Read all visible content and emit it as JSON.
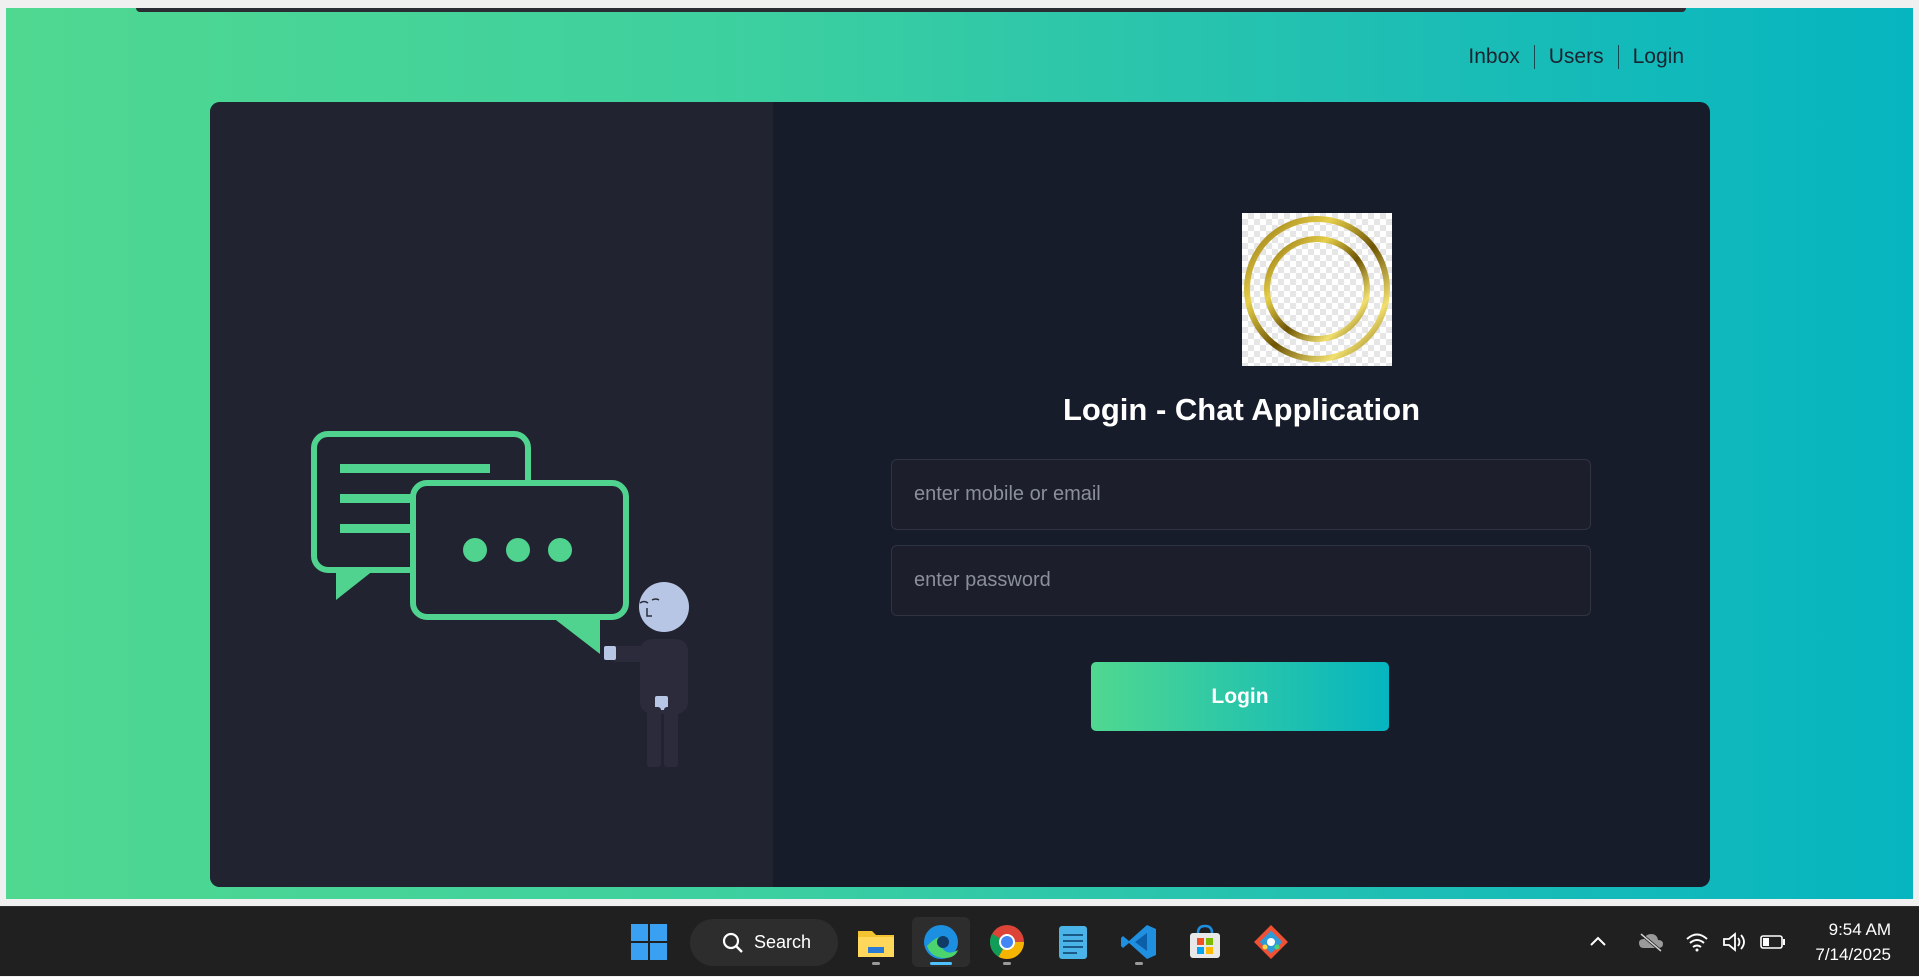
{
  "nav": {
    "items": [
      "Inbox",
      "Users",
      "Login"
    ]
  },
  "login": {
    "title": "Login - Chat Application",
    "email_placeholder": "enter mobile or email",
    "password_placeholder": "enter password",
    "button_label": "Login"
  },
  "taskbar": {
    "search_label": "Search",
    "apps": [
      "windows-start-icon",
      "file-explorer-icon",
      "edge-browser-icon",
      "chrome-icon",
      "notepad-icon",
      "vscode-icon",
      "ms-store-icon",
      "git-icon"
    ],
    "active_app": "edge-browser-icon",
    "time": "9:54 AM",
    "date": "7/14/2025"
  },
  "colors": {
    "accent_start": "#50d890",
    "accent_end": "#06b5c0",
    "card_bg": "#161c2a",
    "card_left_bg": "#212330"
  }
}
